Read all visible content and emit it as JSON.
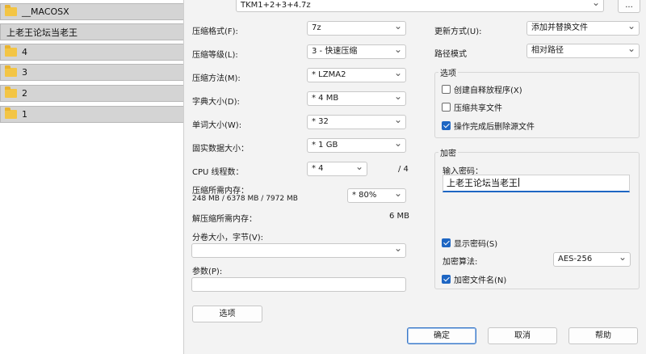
{
  "files": [
    {
      "name": "__MACOSX",
      "icon": "folder-icon"
    },
    {
      "name": "上老王论坛当老王",
      "icon": ""
    },
    {
      "name": "4",
      "icon": "folder-icon"
    },
    {
      "name": "3",
      "icon": "folder-icon"
    },
    {
      "name": "2",
      "icon": "folder-icon"
    },
    {
      "name": "1",
      "icon": "folder-icon"
    }
  ],
  "archive": {
    "name": "TKM1+2+3+4.7z",
    "browse_label": "..."
  },
  "format": {
    "label": "压缩格式(F):",
    "value": "7z"
  },
  "level": {
    "label": "压缩等级(L):",
    "value": "3 - 快速压缩"
  },
  "method": {
    "label": "压缩方法(M):",
    "value": "* LZMA2"
  },
  "dict": {
    "label": "字典大小(D):",
    "value": "* 4 MB"
  },
  "word": {
    "label": "单词大小(W):",
    "value": "* 32"
  },
  "solid": {
    "label": "固实数据大小：",
    "value": "* 1 GB"
  },
  "cpu": {
    "label": "CPU 线程数：",
    "value": "* 4",
    "max": "/ 4"
  },
  "mem": {
    "label": "压缩所需内存：",
    "detail": "248 MB / 6378 MB / 7972 MB",
    "value": "* 80%"
  },
  "decomp": {
    "label": "解压缩所需内存：",
    "value": "6 MB"
  },
  "split": {
    "label": "分卷大小，字节(V):",
    "value": ""
  },
  "params": {
    "label": "参数(P):",
    "value": ""
  },
  "options_button": "选项",
  "update": {
    "label": "更新方式(U):",
    "value": "添加并替换文件"
  },
  "pathmode": {
    "label": "路径模式",
    "value": "相对路径"
  },
  "options_group": {
    "title": "选项",
    "sfx": {
      "label": "创建自释放程序(X)",
      "checked": false
    },
    "shared": {
      "label": "压缩共享文件",
      "checked": false
    },
    "delete": {
      "label": "操作完成后删除源文件",
      "checked": true
    }
  },
  "encryption": {
    "title": "加密",
    "password_label": "输入密码：",
    "password_value": "上老王论坛当老王",
    "show_password": {
      "label": "显示密码(S)",
      "checked": true
    },
    "algo_label": "加密算法:",
    "algo_value": "AES-256",
    "encrypt_names": {
      "label": "加密文件名(N)",
      "checked": true
    }
  },
  "buttons": {
    "ok": "确定",
    "cancel": "取消",
    "help": "帮助"
  }
}
